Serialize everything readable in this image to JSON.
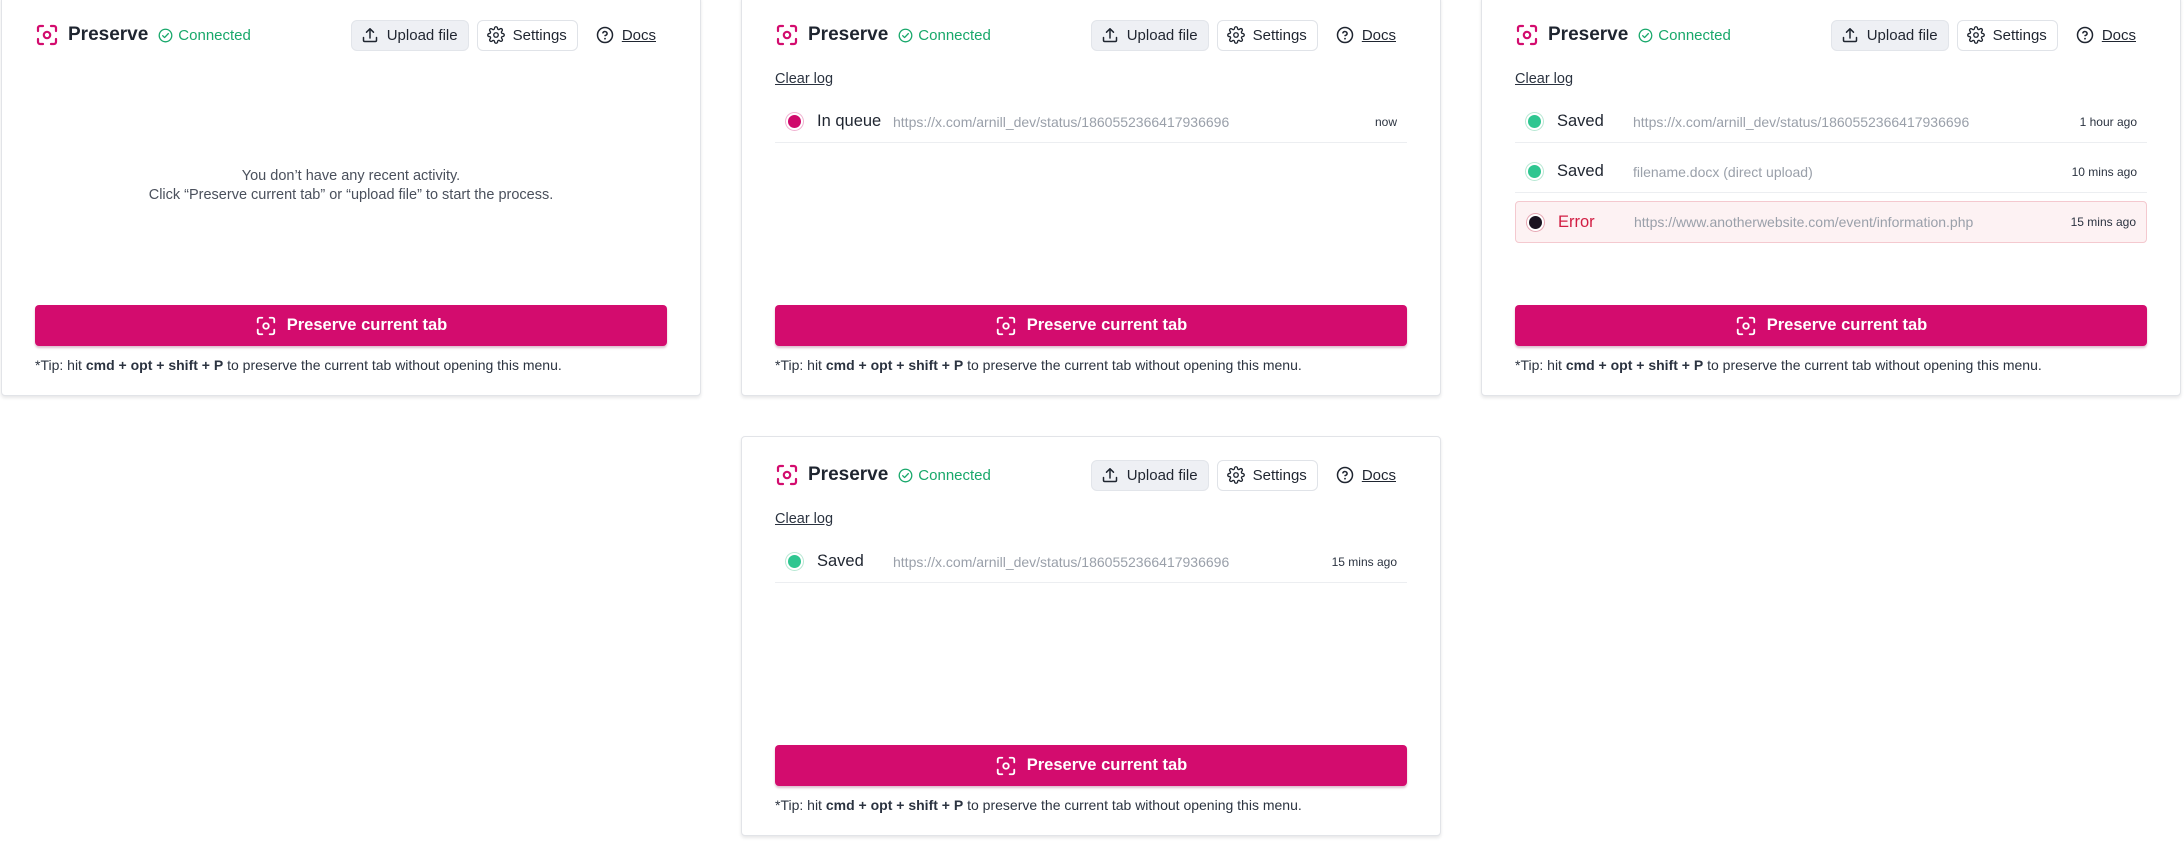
{
  "app": {
    "name": "Preserve",
    "status": "Connected",
    "upload_label": "Upload file",
    "settings_label": "Settings",
    "docs_label": "Docs",
    "clear_log_label": "Clear log",
    "preserve_label": "Preserve current tab",
    "tip": {
      "prefix": "*Tip: hit ",
      "k1": "cmd",
      "sep1": " + ",
      "k2": "opt",
      "sep2": " + ",
      "k3": "shift",
      "sep3": " + ",
      "k4": "P",
      "suffix": " to preserve the current tab without opening this menu."
    }
  },
  "panels": [
    {
      "empty_line1": "You don’t have any recent activity.",
      "empty_line2": "Click “Preserve current tab” or “upload file” to start the process."
    },
    {
      "log": [
        {
          "status": "In queue",
          "url": "https://x.com/arnill_dev/status/1860552366417936696",
          "time": "now"
        }
      ]
    },
    {
      "log": [
        {
          "status": "Saved",
          "url": "https://x.com/arnill_dev/status/1860552366417936696",
          "time": "1 hour ago"
        },
        {
          "status": "Saved",
          "url": "filename.docx (direct upload)",
          "time": "10 mins ago"
        },
        {
          "status": "Error",
          "url": "https://www.anotherwebsite.com/event/information.php",
          "time": "15 mins ago"
        }
      ]
    },
    {
      "log": [
        {
          "status": "Saved",
          "url": "https://x.com/arnill_dev/status/1860552366417936696",
          "time": "15 mins ago"
        }
      ]
    }
  ],
  "colors": {
    "brand": "#d30c6e",
    "connected": "#18a86b",
    "saved": "#2ec690",
    "error": "#d21f44"
  },
  "icons": [
    "preserve-logo-icon",
    "check-circle-icon",
    "upload-icon",
    "gear-icon",
    "help-circle-icon"
  ]
}
